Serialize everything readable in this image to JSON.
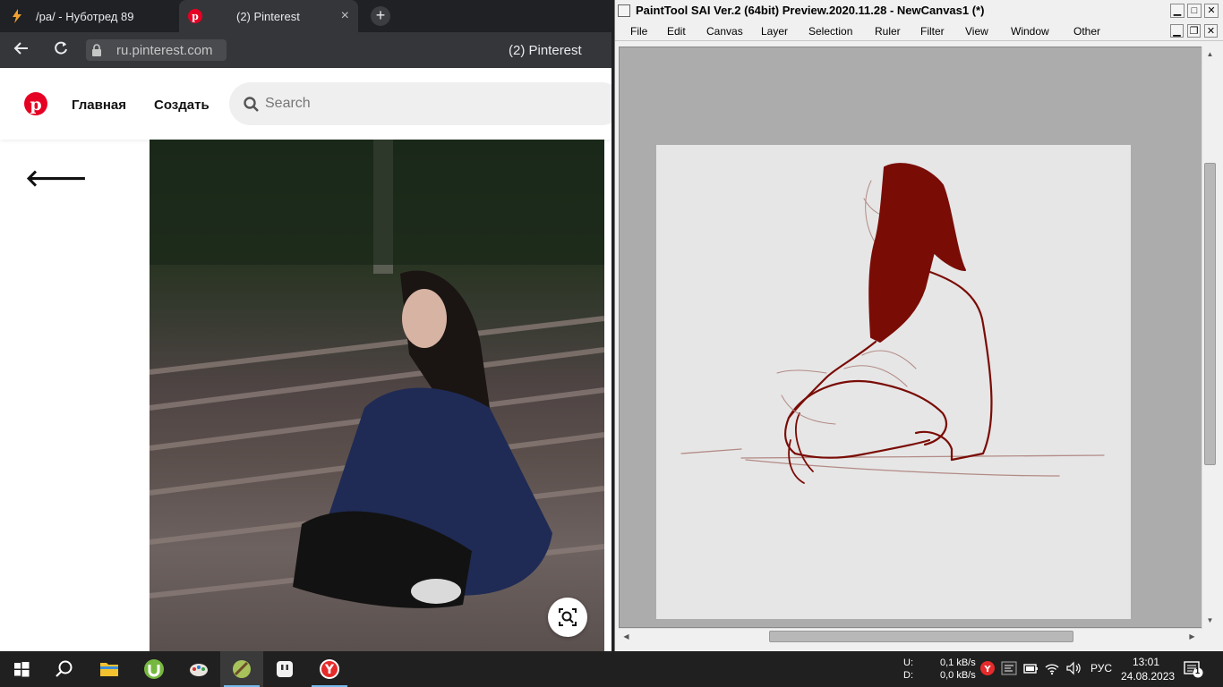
{
  "browser": {
    "tabs": [
      {
        "title": "/ра/ - Нуботред 89",
        "active": false
      },
      {
        "title": "(2) Pinterest",
        "active": true
      }
    ],
    "tab_close": "×",
    "new_tab": "+",
    "url": "ru.pinterest.com",
    "page_title": "(2) Pinterest"
  },
  "pinterest": {
    "nav": {
      "home": "Главная",
      "create": "Создать"
    },
    "search_placeholder": "Search",
    "back": "🡐"
  },
  "sai": {
    "title": "PaintTool SAI Ver.2 (64bit) Preview.2020.11.28 - NewCanvas1 (*)",
    "menu": [
      "File",
      "Edit",
      "Canvas",
      "Layer",
      "Selection",
      "Ruler",
      "Filter",
      "View",
      "Window",
      "Other"
    ],
    "win_buttons": {
      "minimize": "▁",
      "maximize": "□",
      "close": "✕",
      "restore": "❐"
    },
    "stroke_color": "#7a0c06"
  },
  "taskbar": {
    "net_labels": [
      "U:",
      "D:"
    ],
    "net_values": [
      "0,1 kB/s",
      "0,0 kB/s"
    ],
    "language": "РУС",
    "time": "13:01",
    "date": "24.08.2023",
    "notification_count": "1"
  },
  "colors": {
    "pinterest_red": "#e60023",
    "taskbar_bg": "#202020",
    "chrome_dark": "#202124"
  }
}
